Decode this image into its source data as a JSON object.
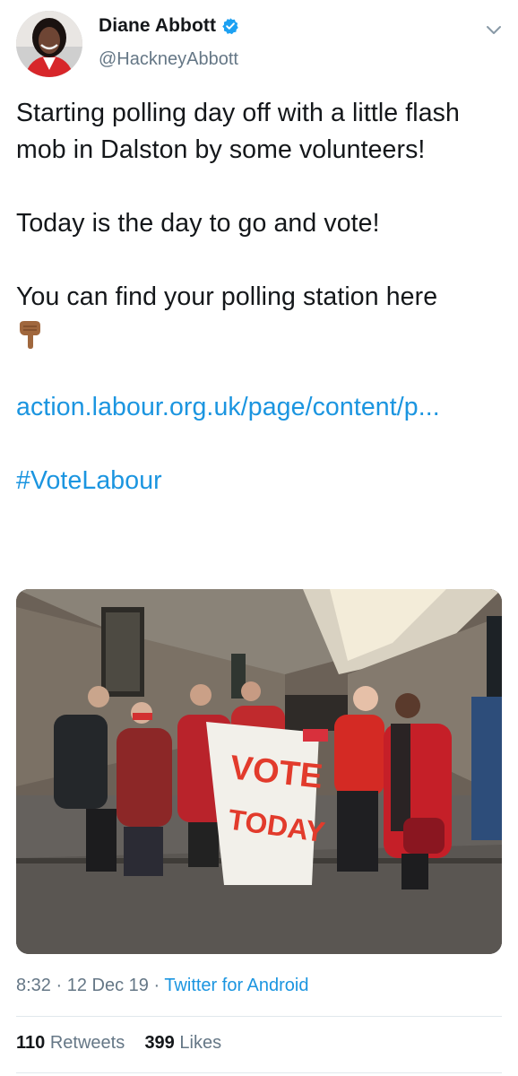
{
  "author": {
    "display_name": "Diane Abbott",
    "handle": "@HackneyAbbott",
    "verified": true
  },
  "tweet": {
    "line1": "Starting polling day off with a little flash mob in Dalston by some volunteers!",
    "line2": "Today is the day to go and vote!",
    "line3": "You can find your polling station here",
    "emoji": "pointing-down-hand",
    "link_text": "action.labour.org.uk/page/content/p...",
    "hashtag": "#VoteLabour"
  },
  "photo": {
    "banner_text_1": "VOTE",
    "banner_text_2": "TODAY"
  },
  "meta": {
    "time": "8:32",
    "separator": " · ",
    "date": "12 Dec 19",
    "source": "Twitter for Android"
  },
  "stats": {
    "retweets_count": "110",
    "retweets_label": "Retweets",
    "likes_count": "399",
    "likes_label": "Likes"
  },
  "colors": {
    "link": "#1b95e0",
    "secondary_text": "#657786",
    "primary_text": "#14171a",
    "divider": "#e1e8ed"
  }
}
